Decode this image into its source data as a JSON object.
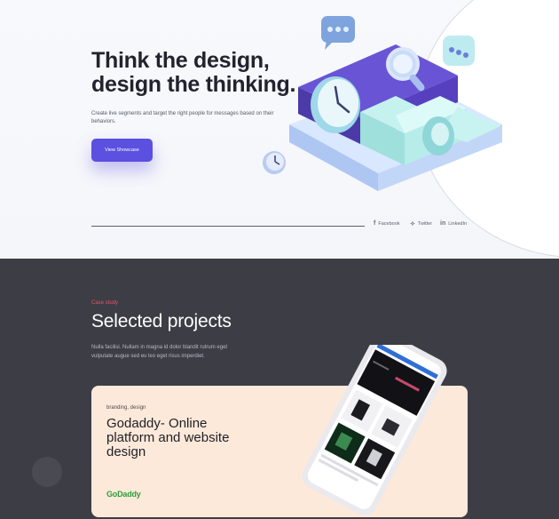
{
  "hero": {
    "title_line1": "Think the design,",
    "title_line2": "design the thinking.",
    "subtitle": "Create live segments and target the right people for messages based on their behaviors.",
    "button_label": "View Showcase",
    "social": [
      {
        "icon": "facebook-icon",
        "glyph": "f",
        "label": "Facebook"
      },
      {
        "icon": "twitter-icon",
        "glyph": "✧",
        "label": "Twitter"
      },
      {
        "icon": "linkedin-icon",
        "glyph": "in",
        "label": "LinkedIn"
      }
    ]
  },
  "projects": {
    "label": "Case study",
    "title": "Selected projects",
    "description": "Nulla facilisi. Nullam in magna id dolor blandit rutrum eget vulputate augue sed eu leo eget risus imperdiet.",
    "card": {
      "tag": "branding, design",
      "title": "Godaddy- Online platform and website design",
      "brand": "GoDaddy"
    }
  },
  "colors": {
    "accent": "#5b50e0",
    "dark_bg": "#3d3d45",
    "card_bg": "#fde9d9",
    "case_label": "#e0566a",
    "brand_green": "#2e9e3c"
  }
}
